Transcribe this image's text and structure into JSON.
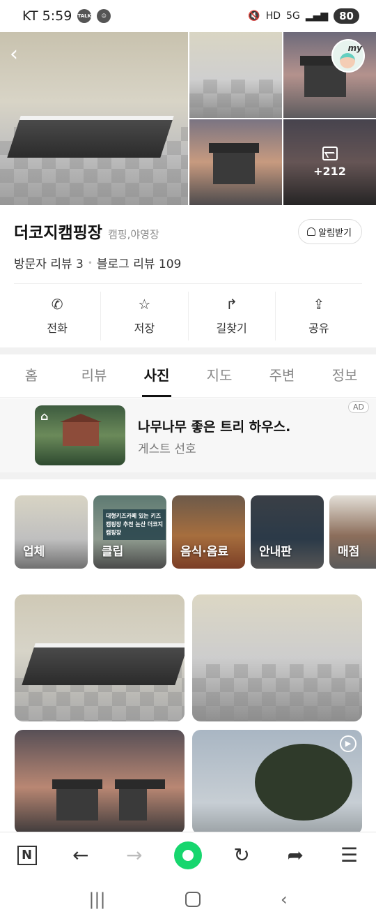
{
  "status_bar": {
    "carrier_time": "KT 5:59",
    "talk_label": "TALK",
    "hd_label": "HD",
    "network_label": "5G",
    "battery": "80"
  },
  "hero": {
    "more_count": "+212"
  },
  "place": {
    "name": "더코지캠핑장",
    "category": "캠핑,야영장",
    "alarm_label": "알림받기",
    "visitor_reviews": "방문자 리뷰 3",
    "blog_reviews": "블로그 리뷰 109"
  },
  "actions": [
    {
      "label": "전화",
      "icon": "phone-icon",
      "glyph": "✆"
    },
    {
      "label": "저장",
      "icon": "star-icon",
      "glyph": "☆"
    },
    {
      "label": "길찾기",
      "icon": "directions-icon",
      "glyph": "↱"
    },
    {
      "label": "공유",
      "icon": "share-icon",
      "glyph": "⇪"
    }
  ],
  "tabs": [
    "홈",
    "리뷰",
    "사진",
    "지도",
    "주변",
    "정보"
  ],
  "active_tab": "사진",
  "ad": {
    "title": "나무나무 좋은 트리 하우스.",
    "subtitle": "게스트 선호",
    "badge": "AD",
    "thumb_banner": ""
  },
  "photo_categories": [
    {
      "label": "업체"
    },
    {
      "label": "클립",
      "banner": "대형키즈카페 있는 키즈캠핑장 추천 논산 더코지캠핑장"
    },
    {
      "label": "음식·음료"
    },
    {
      "label": "안내판"
    },
    {
      "label": "매점"
    }
  ],
  "toolbar": {
    "n_label": "N"
  },
  "colors": {
    "accent_green": "#17d66e",
    "text_primary": "#111111",
    "text_secondary": "#888888"
  }
}
